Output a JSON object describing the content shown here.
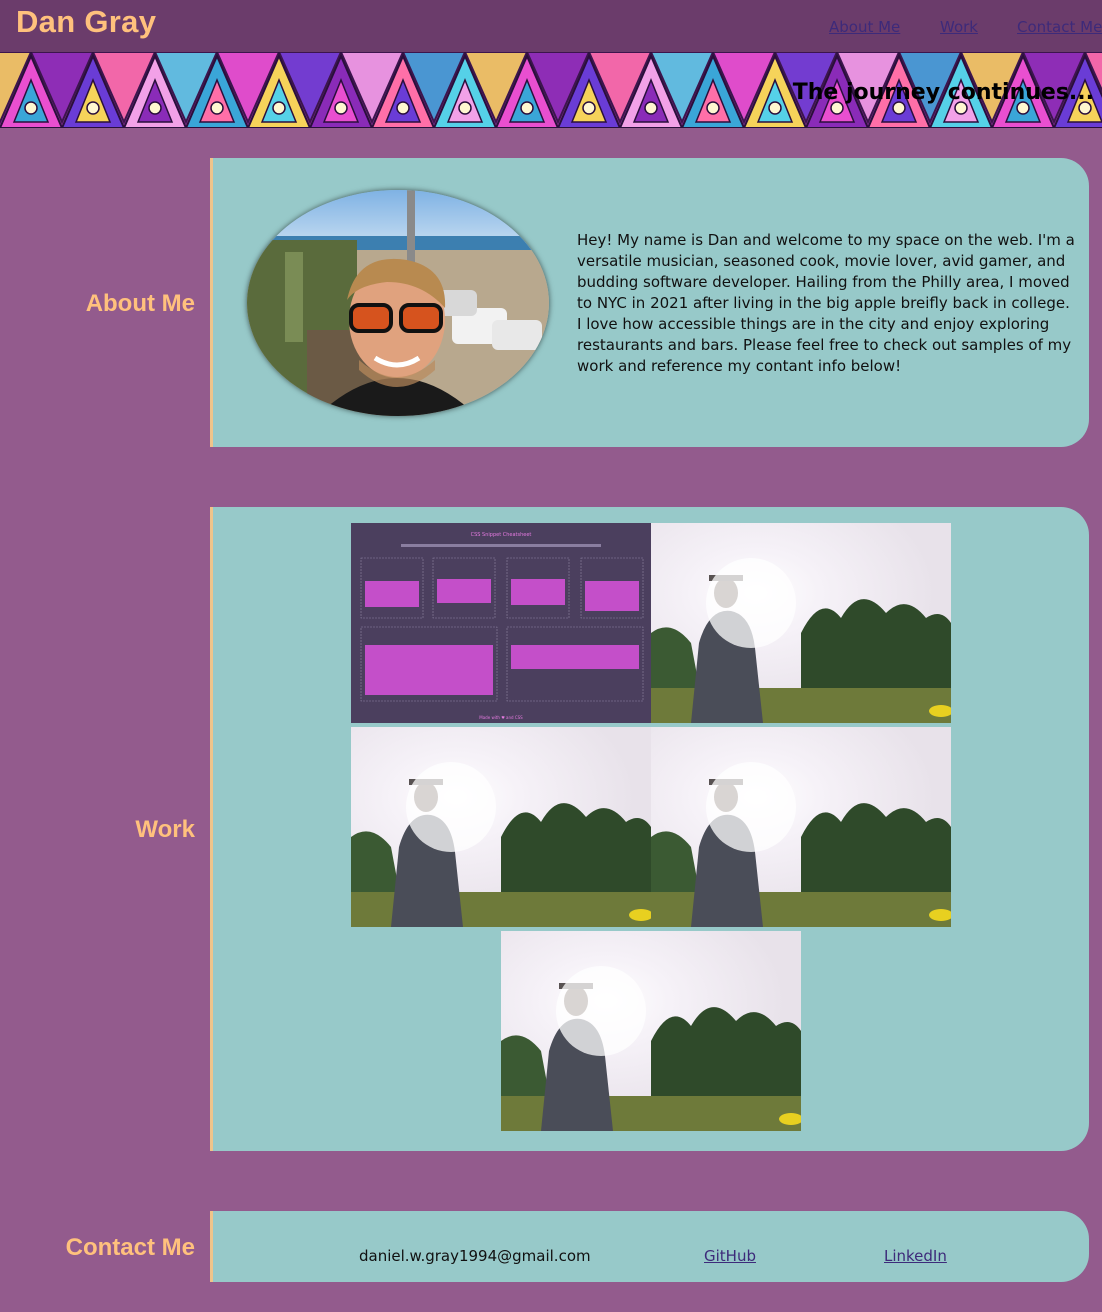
{
  "header": {
    "title": "Dan Gray",
    "nav": [
      "About Me",
      "Work",
      "Contact Me"
    ]
  },
  "banner": {
    "tagline": "The journey continues..."
  },
  "about": {
    "heading": "About Me",
    "text": "Hey! My name is Dan and welcome to my space on the web. I'm a versatile musician, seasoned cook, movie lover, avid gamer, and budding software developer. Hailing from the Philly area, I moved to NYC in 2021 after living in the big apple breifly back in college. I love how accessible things are in the city and enjoy exploring restaurants and bars. Please feel free to check out samples of my work and reference my contant info below!"
  },
  "work": {
    "heading": "Work",
    "screenshot": {
      "title": "CSS Snippet Cheatsheet",
      "footer": "Made with ♥ and CSS"
    }
  },
  "contact": {
    "heading": "Contact Me",
    "email": "daniel.w.gray1994@gmail.com",
    "github": "GitHub",
    "linkedin": "LinkedIn"
  },
  "colors": {
    "background": "#935b8d",
    "header": "#6b3c6b",
    "accent": "#ffc17d",
    "panel": "#97c9c9",
    "link": "#3d2a7a"
  }
}
